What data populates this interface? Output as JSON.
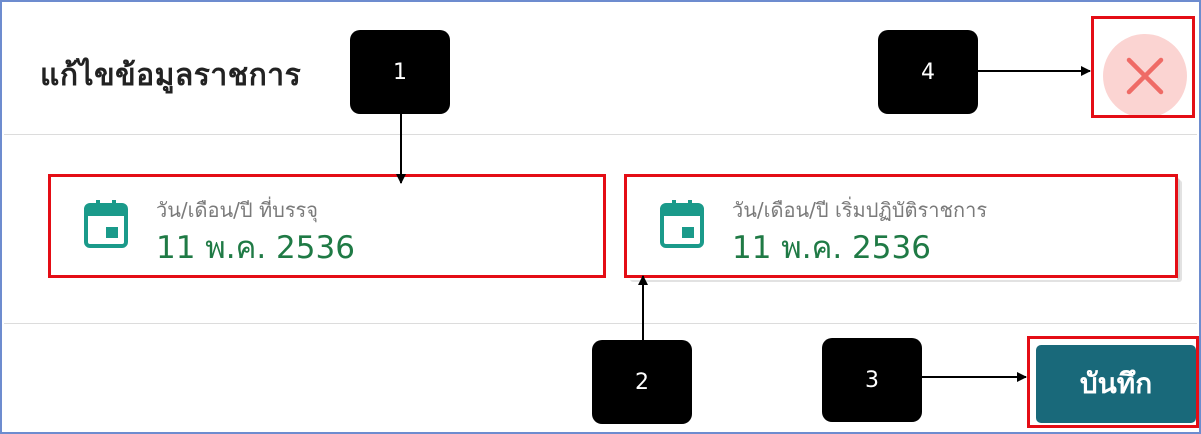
{
  "dialog": {
    "title": "แก้ไขข้อมูลราชการ",
    "close_icon": "close-x-icon",
    "save_label": "บันทึก"
  },
  "fields": [
    {
      "label": "วัน/เดือน/ปี ที่บรรจุ",
      "value": "11 พ.ค. 2536",
      "icon": "calendar-icon"
    },
    {
      "label": "วัน/เดือน/ปี เริ่มปฏิบัติราชการ",
      "value": "11 พ.ค. 2536",
      "icon": "calendar-icon"
    }
  ],
  "callouts": [
    "1",
    "2",
    "3",
    "4"
  ],
  "colors": {
    "accent_teal": "#19697a",
    "icon_teal": "#1a9a8a",
    "value_green": "#1f7a45",
    "highlight_red": "#e40d15",
    "close_bg": "#fbd4d2",
    "close_x": "#ef6b66"
  }
}
